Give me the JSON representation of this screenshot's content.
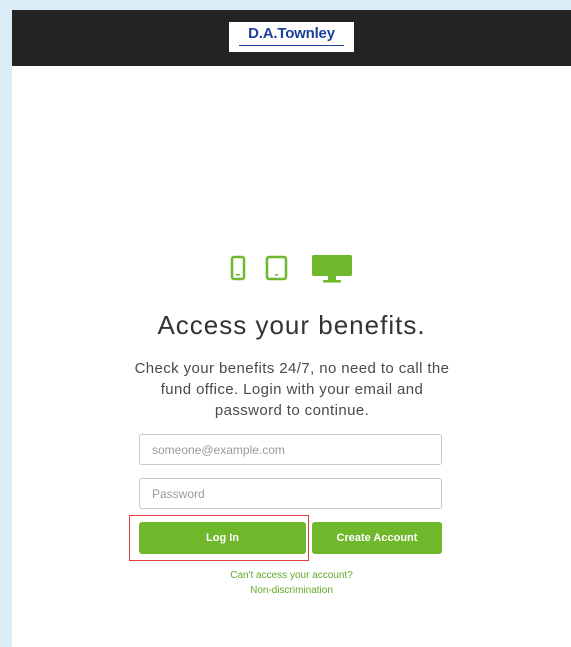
{
  "header": {
    "logo_text": "D.A.Townley"
  },
  "devices": {
    "icons": [
      "phone-icon",
      "tablet-icon",
      "desktop-icon"
    ],
    "accent_color": "#6fb72b"
  },
  "main": {
    "headline": "Access your benefits.",
    "subtext": "Check your benefits 24/7, no need to call the fund office. Login with your email and password to continue."
  },
  "form": {
    "email_placeholder": "someone@example.com",
    "email_value": "",
    "password_placeholder": "Password",
    "password_value": "",
    "login_label": "Log In",
    "create_account_label": "Create Account"
  },
  "links": {
    "cant_access": "Can't access your account?",
    "non_discrimination": "Non-discrimination"
  },
  "colors": {
    "topbar": "#222322",
    "button": "#6fb72b",
    "logo_text": "#1c3f9a",
    "highlight": "#e23b3b"
  }
}
